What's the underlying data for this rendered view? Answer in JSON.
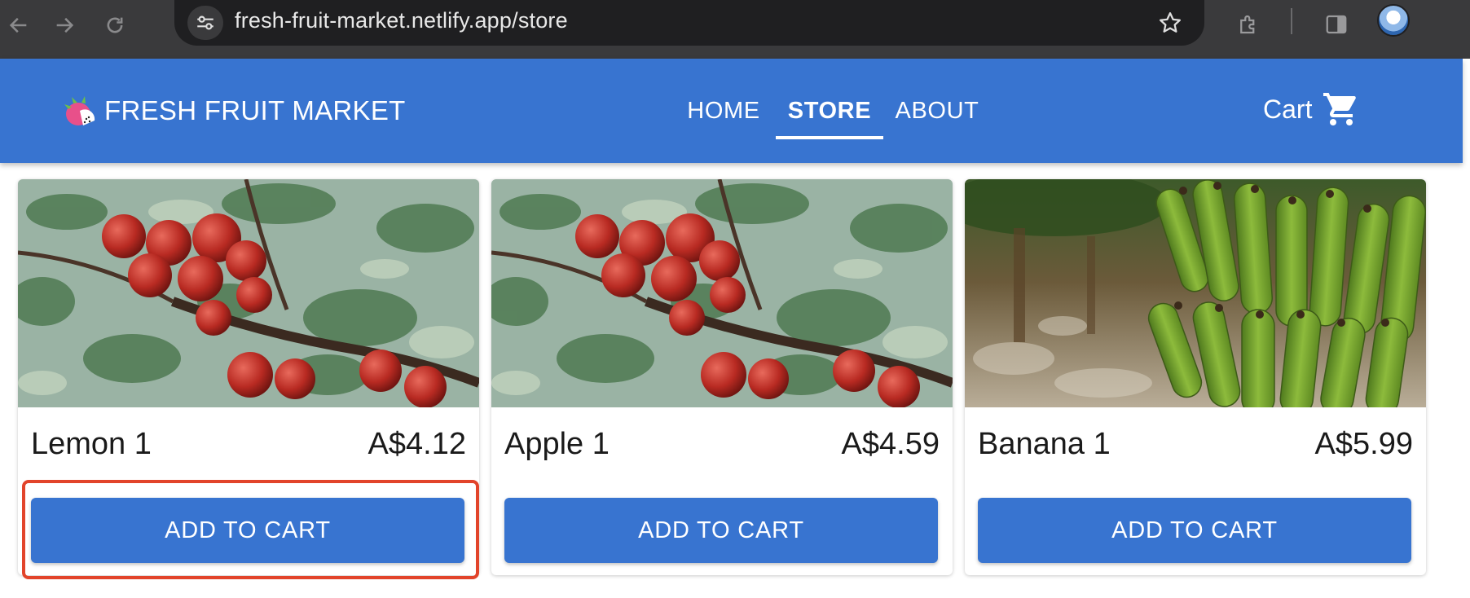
{
  "browser": {
    "url": "fresh-fruit-market.netlify.app/store",
    "icons": [
      "back-arrow-icon",
      "forward-arrow-icon",
      "reload-icon",
      "site-info-icon",
      "star-icon",
      "extensions-icon",
      "side-panel-icon",
      "profile-avatar"
    ]
  },
  "header": {
    "brand": "FRESH FRUIT MARKET",
    "brand_icon": "dragon-fruit-logo",
    "nav": [
      {
        "label": "HOME",
        "active": false
      },
      {
        "label": "STORE",
        "active": true
      },
      {
        "label": "ABOUT",
        "active": false
      }
    ],
    "cart_label": "Cart",
    "cart_icon": "shopping-cart-icon"
  },
  "products": [
    {
      "name": "Lemon 1",
      "price": "A$4.12",
      "button": "ADD TO CART",
      "image": "apple-tree-photo"
    },
    {
      "name": "Apple 1",
      "price": "A$4.59",
      "button": "ADD TO CART",
      "image": "apple-tree-photo"
    },
    {
      "name": "Banana 1",
      "price": "A$5.99",
      "button": "ADD TO CART",
      "image": "banana-bunch-photo"
    }
  ],
  "colors": {
    "primary": "#3874d0",
    "highlight": "#e2442b",
    "chrome_dark": "#3a3a3c"
  }
}
